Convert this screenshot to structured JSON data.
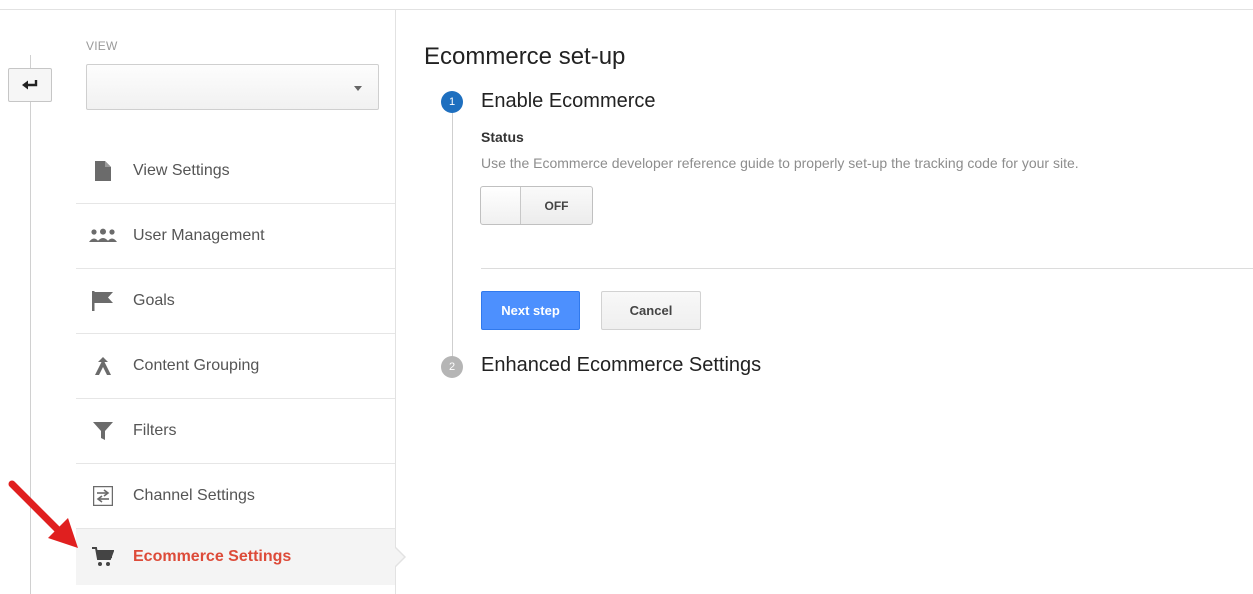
{
  "sidebar": {
    "view_label": "VIEW",
    "view_select_value": "",
    "items": [
      {
        "label": "View Settings",
        "icon": "document-icon"
      },
      {
        "label": "User Management",
        "icon": "users-icon"
      },
      {
        "label": "Goals",
        "icon": "flag-icon"
      },
      {
        "label": "Content Grouping",
        "icon": "content-grouping-icon"
      },
      {
        "label": "Filters",
        "icon": "filter-icon"
      },
      {
        "label": "Channel Settings",
        "icon": "channel-settings-icon"
      },
      {
        "label": "Ecommerce Settings",
        "icon": "cart-icon",
        "active": true
      }
    ]
  },
  "main": {
    "title": "Ecommerce set-up",
    "steps": [
      {
        "number": "1",
        "title": "Enable Ecommerce"
      },
      {
        "number": "2",
        "title": "Enhanced Ecommerce Settings"
      }
    ],
    "status_label": "Status",
    "status_description": "Use the Ecommerce developer reference guide to properly set-up the tracking code for your site.",
    "toggle_state": "OFF",
    "next_button": "Next step",
    "cancel_button": "Cancel"
  },
  "colors": {
    "active_nav": "#dd4b39",
    "primary_button": "#4d90fe",
    "step_active": "#1e6fbf",
    "step_inactive": "#b5b5b5",
    "annotation_arrow": "#e01f1f"
  }
}
